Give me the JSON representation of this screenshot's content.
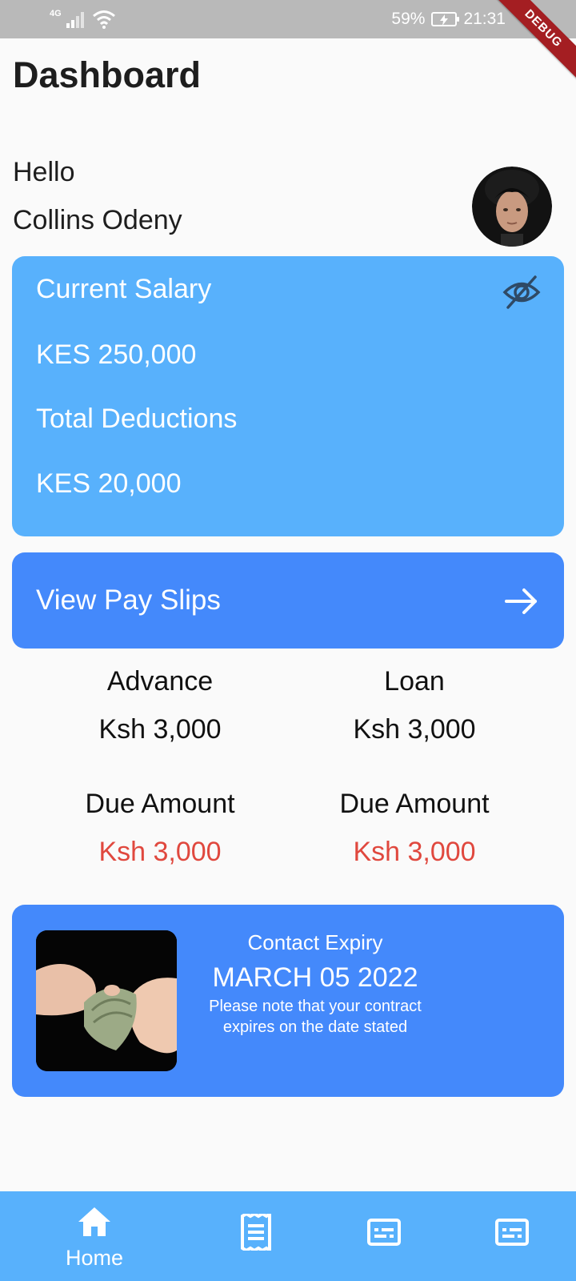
{
  "status_bar": {
    "network": "4G",
    "battery_percent": "59%",
    "time": "21:31",
    "debug_label": "DEBUG"
  },
  "header": {
    "title": "Dashboard",
    "greeting": "Hello",
    "user_name": "Collins Odeny"
  },
  "salary_card": {
    "salary_label": "Current Salary",
    "salary_value": "KES 250,000",
    "deductions_label": "Total Deductions",
    "deductions_value": "KES 20,000",
    "toggle_icon": "eye-off-icon"
  },
  "payslips": {
    "label": "View Pay Slips",
    "icon": "arrow-right-icon"
  },
  "stats": {
    "advance": {
      "label": "Advance",
      "value": "Ksh 3,000",
      "due_label": "Due Amount",
      "due_value": "Ksh 3,000"
    },
    "loan": {
      "label": "Loan",
      "value": "Ksh 3,000",
      "due_label": "Due Amount",
      "due_value": "Ksh 3,000"
    }
  },
  "contract": {
    "title": "Contact Expiry",
    "date": "MARCH 05 2022",
    "note": "Please note that your contract expires on the date stated"
  },
  "bottom_nav": {
    "items": [
      {
        "label": "Home",
        "icon": "home-icon"
      },
      {
        "label": "",
        "icon": "receipt-icon"
      },
      {
        "label": "",
        "icon": "subtitles-icon"
      },
      {
        "label": "",
        "icon": "subtitles-icon"
      }
    ]
  },
  "colors": {
    "light_blue": "#58b1fc",
    "blue": "#4489fb",
    "due_red": "#e0483e",
    "status_bar": "#b9b9b9",
    "debug_ribbon": "#a41e22"
  }
}
